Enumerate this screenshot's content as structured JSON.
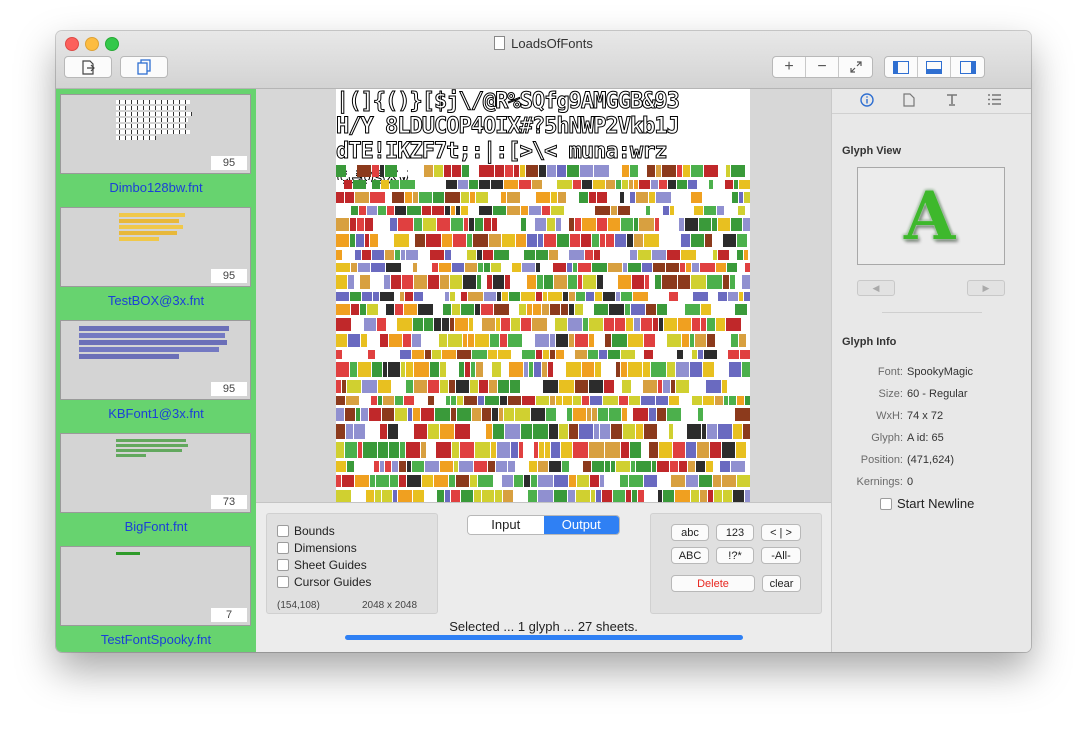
{
  "window": {
    "title": "LoadsOfFonts"
  },
  "toolbar": {
    "zoom_in": "+",
    "zoom_out": "−"
  },
  "sidebar": {
    "items": [
      {
        "name": "Dimbo128bw.fnt",
        "count": "95"
      },
      {
        "name": "TestBOX@3x.fnt",
        "count": "95"
      },
      {
        "name": "KBFont1@3x.fnt",
        "count": "95"
      },
      {
        "name": "BigFont.fnt",
        "count": "73"
      },
      {
        "name": "TestFontSpooky.fnt",
        "count": "7"
      }
    ]
  },
  "canvas": {
    "glyph_lines": [
      "|(]{()}[$j\\/@R%SQfg9AMGGB&93",
      "H/Y 8LDUCOP4OIX#?5hNWP2Vkb1J",
      "dTE!IKZF7t;:|:[>\\<  muna:wrz",
      "ceosxv"
    ]
  },
  "options": {
    "bounds": "Bounds",
    "dimensions": "Dimensions",
    "sheet_guides": "Sheet Guides",
    "cursor_guides": "Cursor Guides",
    "cursor_pos": "(154,108)",
    "sheet_size": "2048 x 2048"
  },
  "mode": {
    "input": "Input",
    "output": "Output"
  },
  "buttons": {
    "abc": "abc",
    "n123": "123",
    "bars": "< | >",
    "ABC": "ABC",
    "punct": "!?*",
    "all": "-All-",
    "delete": "Delete",
    "clear": "clear"
  },
  "status": {
    "text": "Selected ... 1 glyph ... 27 sheets.",
    "progress": 1.0
  },
  "inspector": {
    "glyph_view_title": "Glyph View",
    "glyph_char": "A",
    "nav_prev": "◀",
    "nav_next": "▶",
    "glyph_info_title": "Glyph Info",
    "font_label": "Font:",
    "font": "SpookyMagic",
    "size_label": "Size:",
    "size": "60 - Regular",
    "wxh_label": "WxH:",
    "wxh": "74 x 72",
    "glyph_label": "Glyph:",
    "glyph": "A   id: 65",
    "position_label": "Position:",
    "position": "(471,624)",
    "kernings_label": "Kernings:",
    "kernings": "0",
    "start_newline": "Start Newline"
  },
  "colors": {
    "sidebar": "#67d36f",
    "accent": "#2f80f4",
    "delete": "#e8261f",
    "link": "#1b3fd8"
  }
}
